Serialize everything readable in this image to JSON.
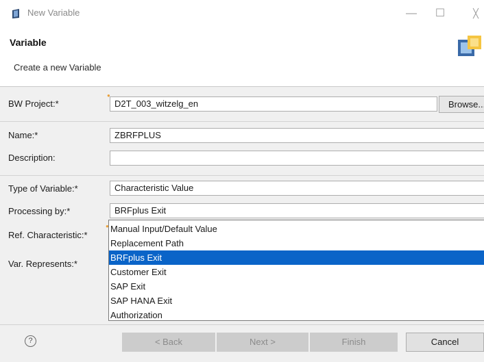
{
  "window": {
    "title": "New Variable",
    "icon": "sap-variable-icon"
  },
  "window_controls": {
    "minimize": "—",
    "maximize": "☐",
    "close": "╳"
  },
  "header": {
    "title": "Variable",
    "description": "Create a new Variable",
    "icon": "wizard-banner-icon"
  },
  "form": {
    "bw_project": {
      "label": "BW Project:*",
      "value": "D2T_003_witzelg_en",
      "browse_label": "Browse..."
    },
    "name": {
      "label": "Name:*",
      "value": "ZBRFPLUS"
    },
    "description": {
      "label": "Description:",
      "value": ""
    },
    "type_of_variable": {
      "label": "Type of Variable:*",
      "value": "Characteristic Value"
    },
    "processing_by": {
      "label": "Processing by:*",
      "value": "BRFplus Exit"
    },
    "ref_characteristic": {
      "label": "Ref. Characteristic:*"
    },
    "var_represents": {
      "label": "Var. Represents:*"
    }
  },
  "dropdown": {
    "items": [
      "Manual Input/Default Value",
      "Replacement Path",
      "BRFplus Exit",
      "Customer Exit",
      "SAP Exit",
      "SAP HANA Exit",
      "Authorization"
    ],
    "selected": "BRFplus Exit"
  },
  "footer": {
    "help": "?",
    "back_label": "< Back",
    "next_label": "Next >",
    "finish_label": "Finish",
    "cancel_label": "Cancel"
  },
  "colors": {
    "selection": "#0a64c8",
    "required_marker": "#e8a03c"
  }
}
